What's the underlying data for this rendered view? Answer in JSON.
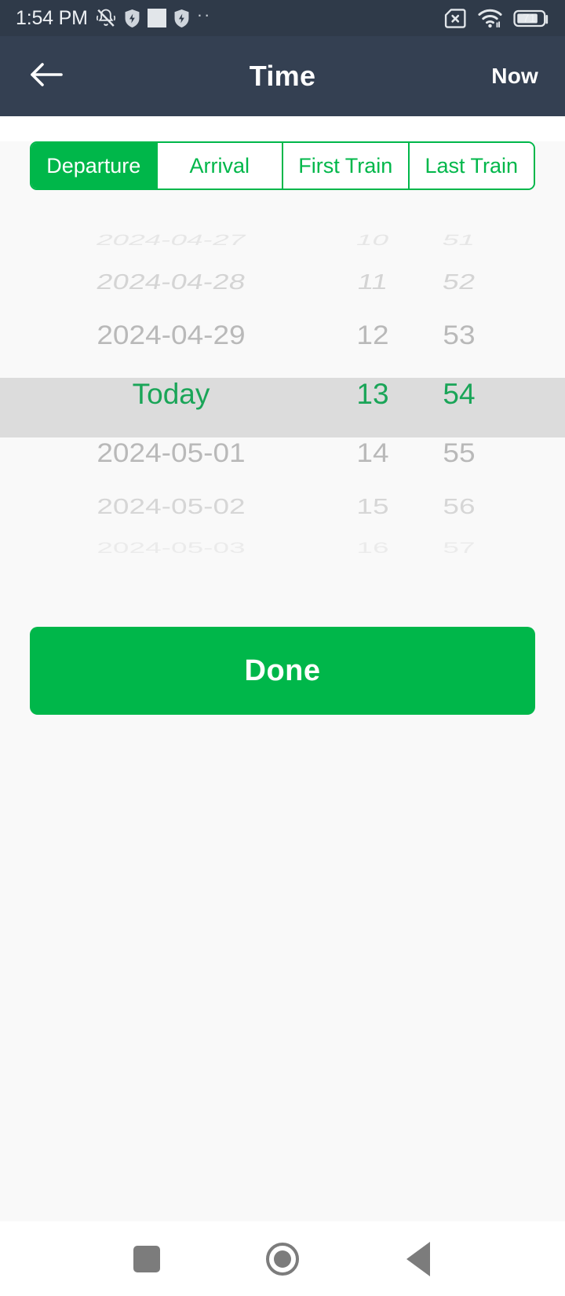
{
  "statusbar": {
    "time": "1:54 PM",
    "battery_percent": "71",
    "icons": [
      "bell-muted-icon",
      "shield-bolt-icon",
      "white-square-icon",
      "shield-bolt-icon",
      "more-dots-icon"
    ],
    "right_icons": [
      "sim-card-x-icon",
      "wifi-icon",
      "battery-icon"
    ],
    "dots": "··"
  },
  "appbar": {
    "back_icon": "arrow-left-icon",
    "title": "Time",
    "action_label": "Now",
    "bg_color": "#344052"
  },
  "segments": {
    "items": [
      {
        "label": "Departure",
        "active": true
      },
      {
        "label": "Arrival",
        "active": false
      },
      {
        "label": "First Train",
        "active": false
      },
      {
        "label": "Last Train",
        "active": false
      }
    ],
    "accent_color": "#00b74a"
  },
  "picker": {
    "selected_index": 3,
    "highlight_color": "#dcdcdc",
    "selected_text_color": "#1aa558",
    "unselected_text_color": "#a8a8a8",
    "rows": [
      {
        "date": "2024-04-27",
        "hour": "10",
        "minute": "51"
      },
      {
        "date": "2024-04-28",
        "hour": "11",
        "minute": "52"
      },
      {
        "date": "2024-04-29",
        "hour": "12",
        "minute": "53"
      },
      {
        "date": "Today",
        "hour": "13",
        "minute": "54"
      },
      {
        "date": "2024-05-01",
        "hour": "14",
        "minute": "55"
      },
      {
        "date": "2024-05-02",
        "hour": "15",
        "minute": "56"
      },
      {
        "date": "2024-05-03",
        "hour": "16",
        "minute": "57"
      }
    ]
  },
  "done": {
    "label": "Done",
    "color": "#00b74a"
  },
  "navbar": {
    "recents_icon": "square-icon",
    "home_icon": "circle-icon",
    "back_icon": "triangle-left-icon"
  }
}
